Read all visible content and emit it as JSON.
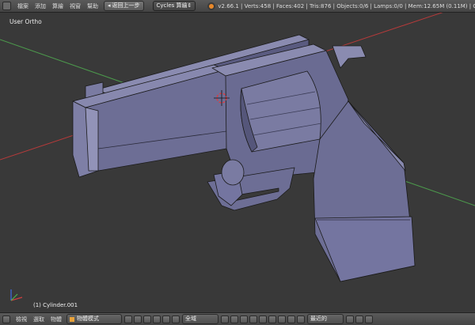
{
  "header": {
    "menus": [
      "檔案",
      "添加",
      "算繪",
      "視窗",
      "幫助"
    ],
    "back_button": "返回上一步",
    "render_engine": "Cycles 算繪",
    "engine_arrow": "⇕",
    "stats": "v2.66.1 | Verts:458 | Faces:402 | Tris:876 | Objects:0/6 | Lamps:0/0 | Mem:12.65M (0.11M) | Cylinder.0"
  },
  "viewport": {
    "view_label": "User Ortho",
    "object_label": "(1) Cylinder.001"
  },
  "footer": {
    "menus": [
      "檢視",
      "選取",
      "物體"
    ],
    "mode": "物體模式",
    "pivot": "全域",
    "proportional": "最近的"
  },
  "colors": {
    "header_bg": "#4a4a4a",
    "viewport_bg": "#393939",
    "model_face": "#6d6e95",
    "x_axis": "#b33a3a",
    "y_axis": "#4c9a4c",
    "blender_orange": "#e8882a"
  }
}
